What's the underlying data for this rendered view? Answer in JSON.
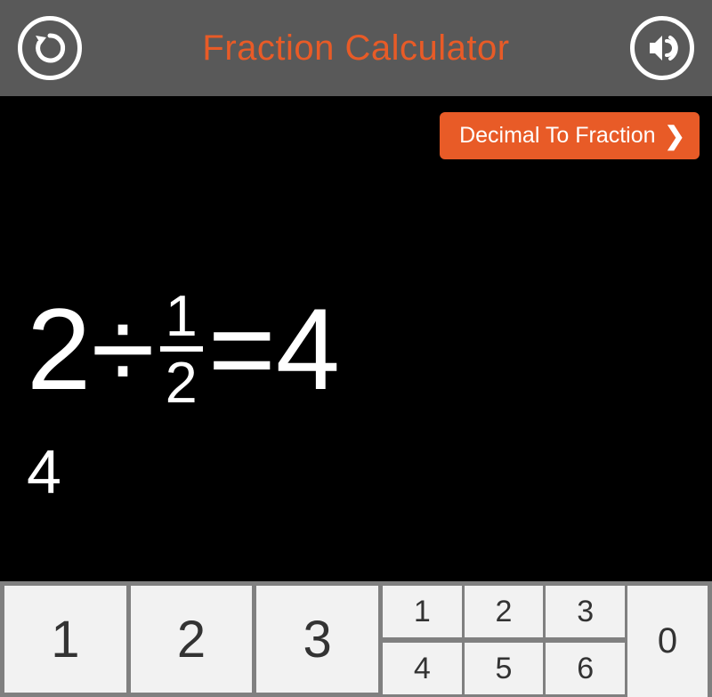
{
  "header": {
    "title": "Fraction Calculator"
  },
  "mode_button": {
    "label": "Decimal To Fraction"
  },
  "equation": {
    "left_operand": "2",
    "operator": "÷",
    "fraction_numerator": "1",
    "fraction_denominator": "2",
    "equals": "=",
    "result": "4"
  },
  "decimal_result": "4",
  "keypad": {
    "large": [
      "1",
      "2",
      "3"
    ],
    "small": [
      "1",
      "2",
      "3",
      "4",
      "5",
      "6"
    ],
    "zero": "0"
  },
  "colors": {
    "accent": "#e85b27",
    "header_bg": "#595959",
    "key_bg": "#f2f2f2"
  }
}
